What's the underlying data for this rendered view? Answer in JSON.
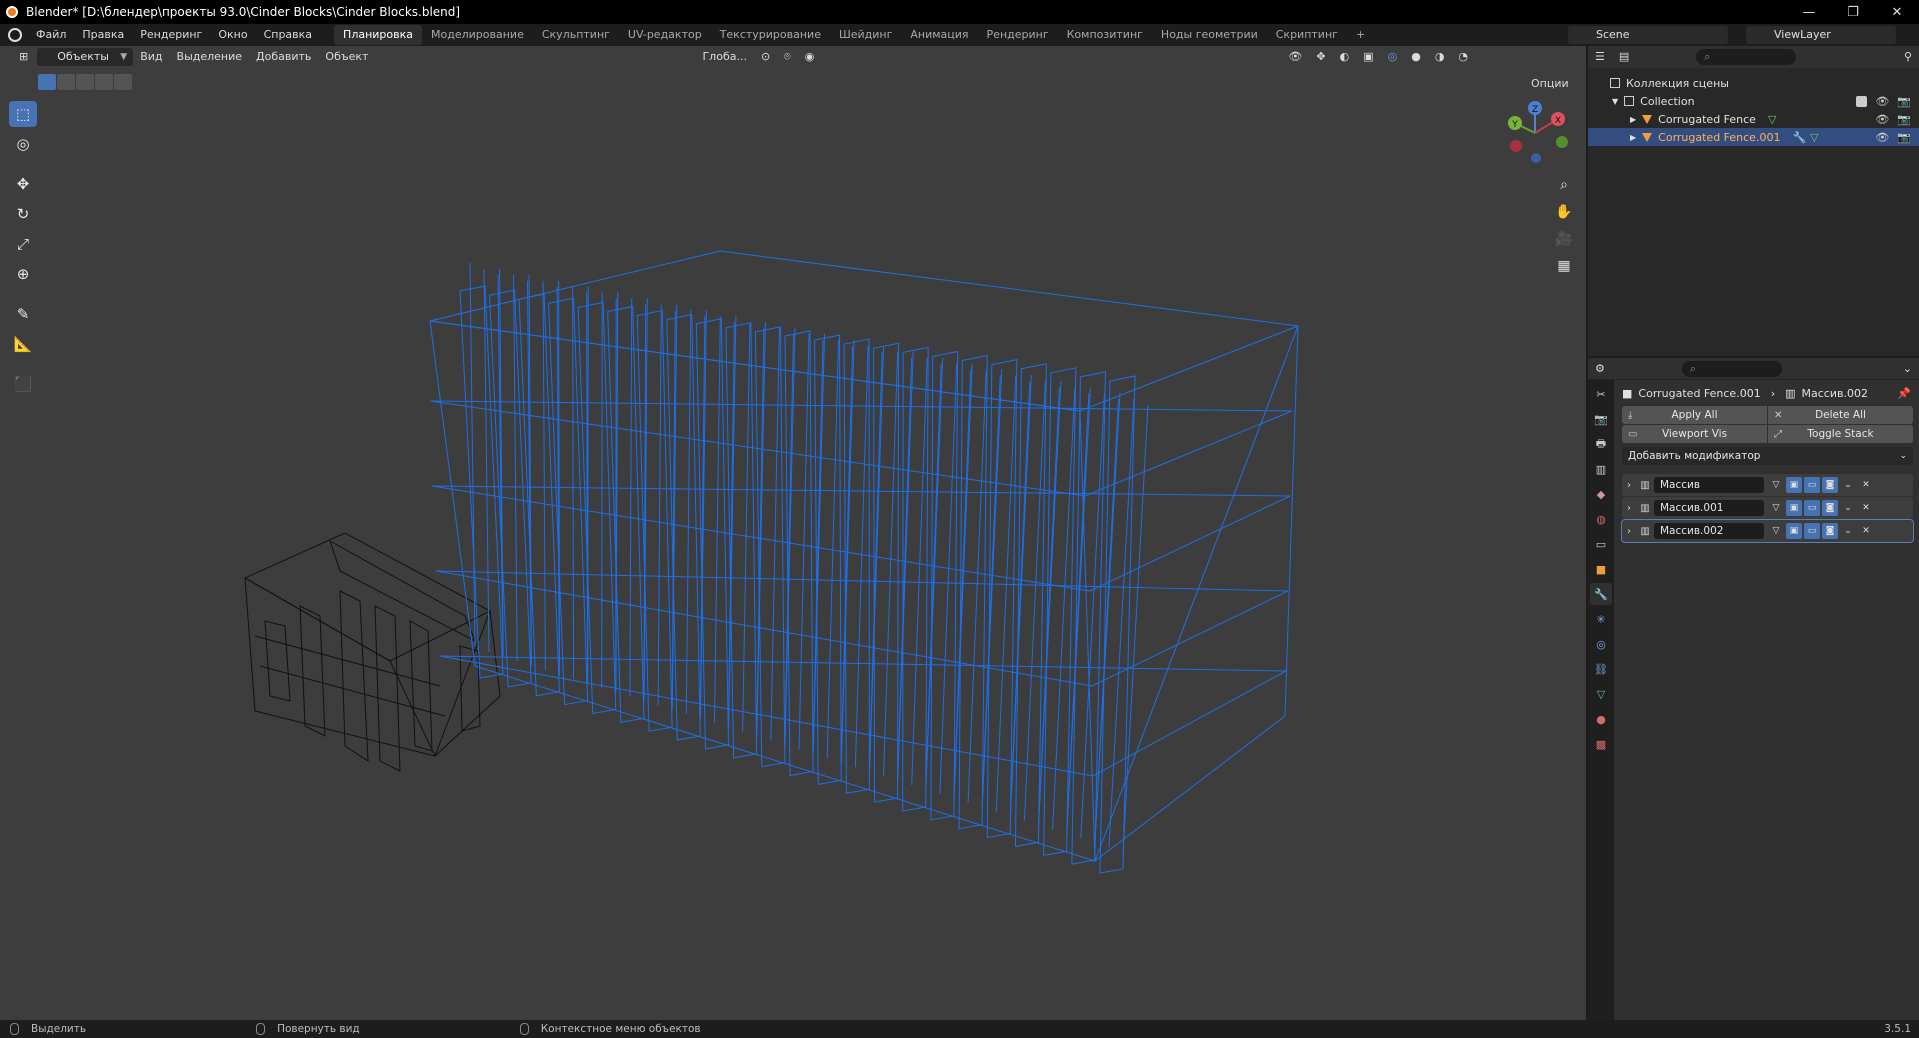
{
  "window": {
    "title": "Blender* [D:\\блендер\\проекты 93.0\\Cinder Blocks\\Cinder Blocks.blend]",
    "minimize": "—",
    "restore": "❐",
    "close": "✕"
  },
  "menu": [
    "Файл",
    "Правка",
    "Рендеринг",
    "Окно",
    "Справка"
  ],
  "workspaces": [
    {
      "label": "Планировка",
      "active": true
    },
    {
      "label": "Моделирование"
    },
    {
      "label": "Скульптинг"
    },
    {
      "label": "UV-редактор"
    },
    {
      "label": "Текстурирование"
    },
    {
      "label": "Шейдинг"
    },
    {
      "label": "Анимация"
    },
    {
      "label": "Рендеринг"
    },
    {
      "label": "Композитинг"
    },
    {
      "label": "Ноды геометрии"
    },
    {
      "label": "Скриптинг"
    }
  ],
  "add_workspace": "+",
  "scene": {
    "name": "Scene",
    "view_layer": "ViewLayer"
  },
  "viewport": {
    "mode": "Объекты",
    "menus": [
      "Вид",
      "Выделение",
      "Добавить",
      "Объект"
    ],
    "orientation": "Глоба...",
    "options": "Опции",
    "gizmo": {
      "x": "X",
      "y": "Y",
      "z": "Z"
    }
  },
  "status": {
    "left": "Выделить",
    "middle": "Повернуть вид",
    "right": "Контекстное меню объектов",
    "version": "3.5.1"
  },
  "outliner": {
    "search_placeholder": "⌕",
    "root": "Коллекция сцены",
    "collection": "Collection",
    "objects": [
      {
        "name": "Corrugated Fence",
        "selected": false
      },
      {
        "name": "Corrugated Fence.001",
        "selected": true
      }
    ]
  },
  "properties": {
    "search_placeholder": "⌕",
    "breadcrumb_object": "Corrugated Fence.001",
    "breadcrumb_modifier": "Массив.002",
    "apply_all": "Apply All",
    "delete_all": "Delete All",
    "viewport_vis": "Viewport Vis",
    "toggle_stack": "Toggle Stack",
    "add_modifier": "Добавить модификатор",
    "modifiers": [
      {
        "name": "Массив"
      },
      {
        "name": "Массив.001"
      },
      {
        "name": "Массив.002",
        "active": true
      }
    ]
  },
  "colors": {
    "selected_wire": "#1f6fe6",
    "unselected_wire": "#000000",
    "accent": "#4772b3",
    "viewport_bg": "#3d3d3d"
  }
}
